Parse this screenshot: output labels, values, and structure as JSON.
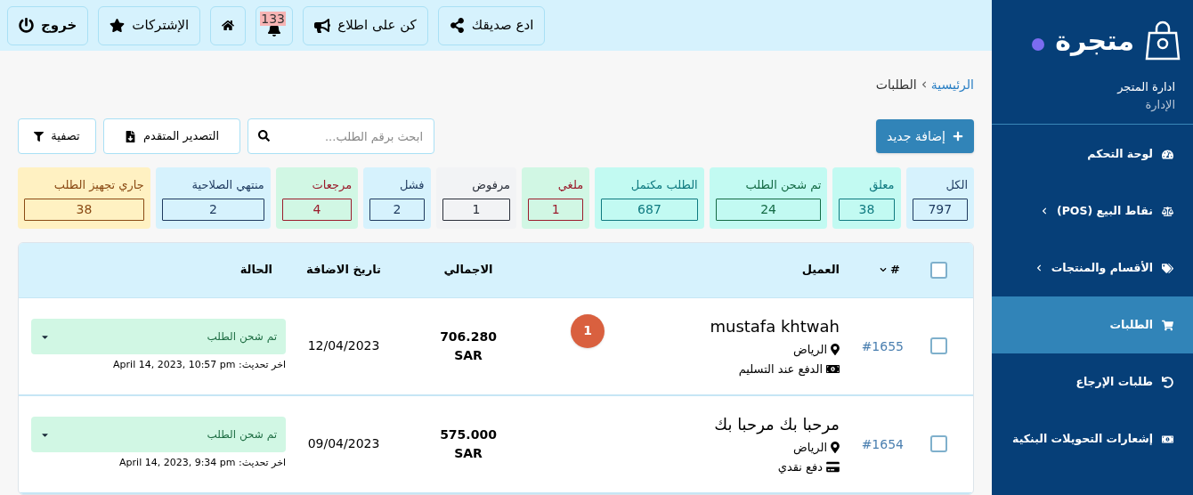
{
  "top_bar": {
    "buttons": [
      {
        "kind": "share",
        "label": "ادع صديقك"
      },
      {
        "kind": "announce",
        "label": "كن على اطلاع"
      },
      {
        "kind": "bell",
        "label": "133"
      },
      {
        "kind": "home"
      },
      {
        "kind": "star",
        "label": "الإشتركات"
      },
      {
        "kind": "logout",
        "label": "خروج"
      }
    ]
  },
  "sidebar": {
    "logo": "متجرة",
    "store_title": "ادارة المتجر",
    "store_role": "الإدارة",
    "items": [
      {
        "kind": "dashboard",
        "label": "لوحة التحكم",
        "expandable": false,
        "selected": false
      },
      {
        "kind": "scale",
        "label": "نقاط البيع (POS)",
        "expandable": true,
        "selected": false
      },
      {
        "kind": "tags",
        "label": "الأقسام والمنتجات",
        "expandable": true,
        "selected": false
      },
      {
        "kind": "cart",
        "label": "الطلبات",
        "expandable": false,
        "selected": true
      },
      {
        "kind": "undo",
        "label": "طلبات الإرجاع",
        "expandable": false,
        "selected": false
      },
      {
        "kind": "money",
        "label": "إشعارات التحويلات البنكية",
        "expandable": false,
        "selected": false
      }
    ]
  },
  "breadcrumb": [
    {
      "label": "الرئيسية",
      "link": true
    },
    {
      "label": "الطلبات",
      "link": false
    }
  ],
  "toolbar": {
    "add_button": "إضافة جديد",
    "search": {
      "placeholder": "ابحث برقم الطلب..."
    },
    "export_button": "التصدير المتقدم",
    "filter_button": "تصفية"
  },
  "status_cards": [
    {
      "label": "الكل",
      "count": "797",
      "color": "#d6f2fd",
      "kind": "info"
    },
    {
      "label": "معلق",
      "count": "38",
      "color": "#c2faf2",
      "kind": "teal"
    },
    {
      "label": "تم شحن الطلب",
      "count": "24",
      "color": "#c2faf2",
      "kind": "success"
    },
    {
      "label": "الطلب مكتمل",
      "count": "687",
      "color": "#c2faf2",
      "kind": "teal"
    },
    {
      "label": "ملغي",
      "count": "1",
      "color": "#d1f7e4",
      "kind": "danger"
    },
    {
      "label": "مرفوض",
      "count": "1",
      "color": "#f2f3f5",
      "kind": "neutral"
    },
    {
      "label": "فشل",
      "count": "2",
      "color": "#d6f2fd",
      "kind": "info"
    },
    {
      "label": "مرجعات",
      "count": "4",
      "color": "#d1f7e4",
      "kind": "danger"
    },
    {
      "label": "منتهي الصلاحية",
      "count": "2",
      "color": "#d6f2fd",
      "kind": "info"
    },
    {
      "label": "جاري تجهيز الطلب",
      "count": "38",
      "color": "#fff1c2",
      "kind": "warning"
    }
  ],
  "table": {
    "select_all_checked": false,
    "columns": [
      "#",
      "العميل",
      "الاجمالي",
      "تاريخ الاضافة",
      "الحالة"
    ],
    "rows": [
      {
        "checked": false,
        "id": "#1655",
        "customer": "mustafa khtwah",
        "city": "الرياض",
        "payment": "الدفع عند التسليم",
        "kind": "cash",
        "badge": "1",
        "total": "706.280",
        "currency": "SAR",
        "date": "12/04/2023",
        "status": "تم شحن الطلب",
        "updated": "اخر تحديث: April 14, 2023, 10:57 pm"
      },
      {
        "checked": false,
        "id": "#1654",
        "customer": "مرحبا بك مرحبا بك",
        "city": "الرياض",
        "payment": "دفع نقدي",
        "kind": "card",
        "total": "575.000",
        "currency": "SAR",
        "date": "09/04/2023",
        "status": "تم شحن الطلب",
        "updated": "اخر تحديث: April 14, 2023, 9:34 pm"
      }
    ]
  }
}
